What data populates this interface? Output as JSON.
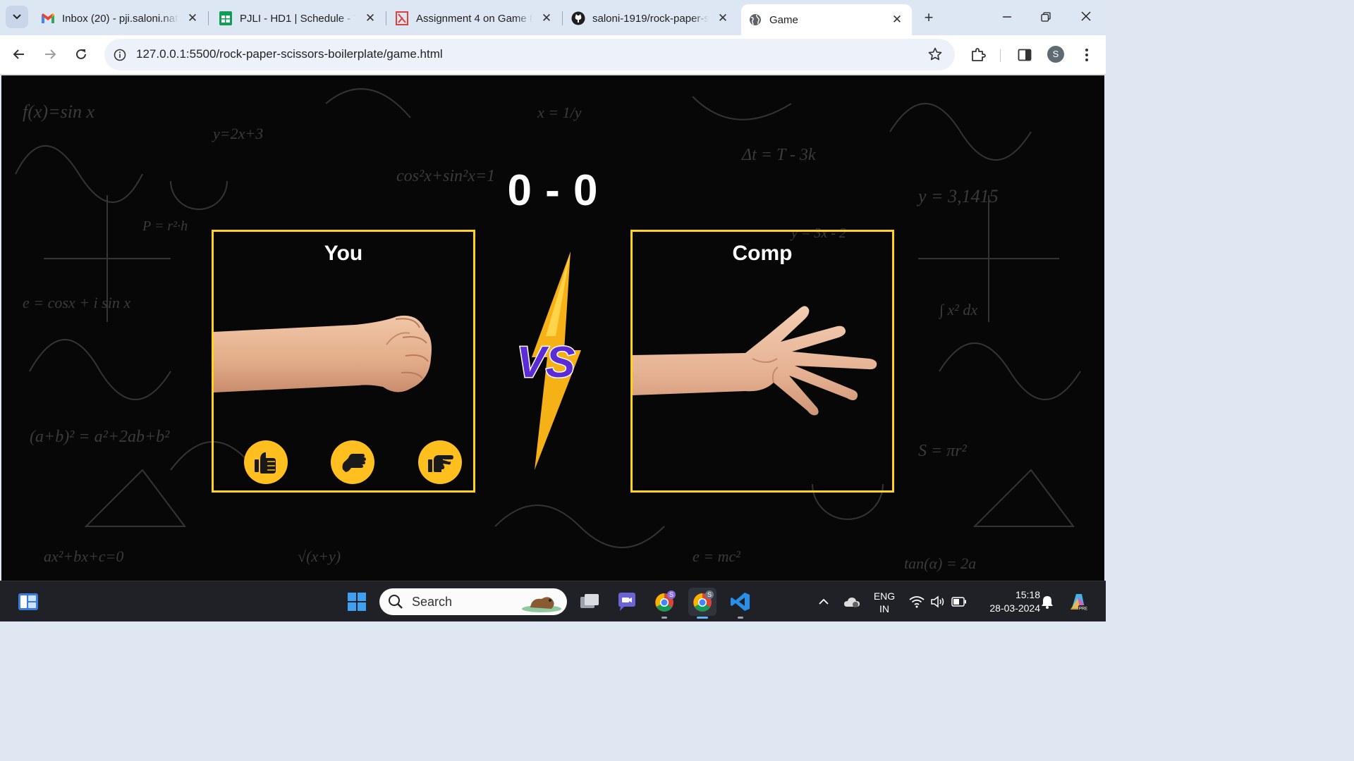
{
  "browser": {
    "tabs": [
      {
        "title": "Inbox (20) - pji.saloni.natl",
        "icon": "gmail-icon"
      },
      {
        "title": "PJLI - HD1 | Schedule - Te",
        "icon": "sheets-icon"
      },
      {
        "title": "Assignment 4 on Game D",
        "icon": "assignment-icon"
      },
      {
        "title": "saloni-1919/rock-paper-s",
        "icon": "github-icon"
      },
      {
        "title": "Game",
        "icon": "globe-icon"
      }
    ],
    "close_glyph": "✕",
    "new_tab_glyph": "+",
    "url": "127.0.0.1:5500/rock-paper-scissors-boilerplate/game.html",
    "profile_initial": "S"
  },
  "game": {
    "score": "0 - 0",
    "player_label": "You",
    "computer_label": "Comp",
    "player_choice": "rock",
    "computer_choice": "paper",
    "choices": [
      {
        "name": "rock",
        "icon": "fist-icon"
      },
      {
        "name": "paper",
        "icon": "palm-icon"
      },
      {
        "name": "scissors",
        "icon": "scissors-hand-icon"
      }
    ],
    "vs_text": "VS",
    "colors": {
      "accent": "#ffd21f",
      "button": "#ffc01f",
      "vs_purple": "#5b2bd6",
      "background": "#070707"
    }
  },
  "taskbar": {
    "search_label": "Search",
    "language": "ENG",
    "region": "IN",
    "time": "15:18",
    "date": "28-03-2024"
  }
}
